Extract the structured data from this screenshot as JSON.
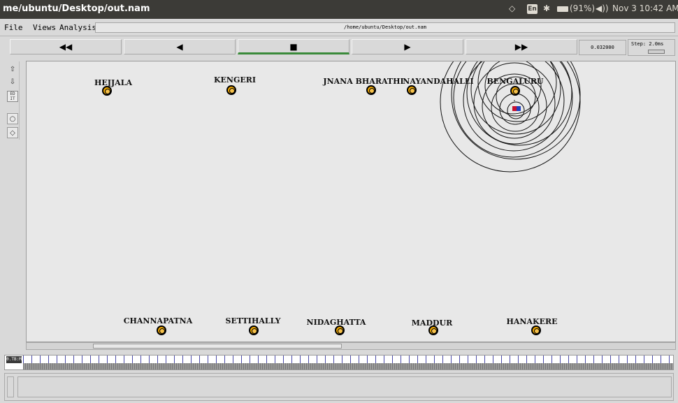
{
  "topbar": {
    "window_title": "me/ubuntu/Desktop/out.nam",
    "keyboard_lang": "En",
    "battery": "(91%)",
    "datetime": "Nov 3 10:42 AM"
  },
  "menu": {
    "file": "File",
    "views": "Views",
    "analysis": "Analysis",
    "file_path": "/home/ubuntu/Desktop/out.nam"
  },
  "transport": {
    "rewind": "◀◀",
    "back": "◀",
    "stop": "■",
    "play": "▶",
    "fast_forward": "▶▶",
    "time": "0.032000",
    "step": "Step: 2.0ms"
  },
  "timeline": {
    "marker": "0.TB:M"
  },
  "nodes": [
    {
      "id": "0",
      "label": "BENGALURU"
    },
    {
      "id": "1",
      "label": "NAYANDAHALLI"
    },
    {
      "id": "2",
      "label": "JNANA BHARATHI"
    },
    {
      "id": "3",
      "label": "KENGERI"
    },
    {
      "id": "4",
      "label": "HEJJALA"
    },
    {
      "id": "7",
      "label": "CHANNAPATNA"
    },
    {
      "id": "8",
      "label": "SETTIHALLY"
    },
    {
      "id": "9",
      "label": "NIDAGHATTA"
    },
    {
      "id": "10",
      "label": "MADDUR"
    },
    {
      "id": "11",
      "label": "HANAKERE"
    }
  ],
  "colors": {
    "node_fill": "#f2a900",
    "canvas_bg": "#e8e8e8",
    "active_button": "#3a8a3a"
  }
}
